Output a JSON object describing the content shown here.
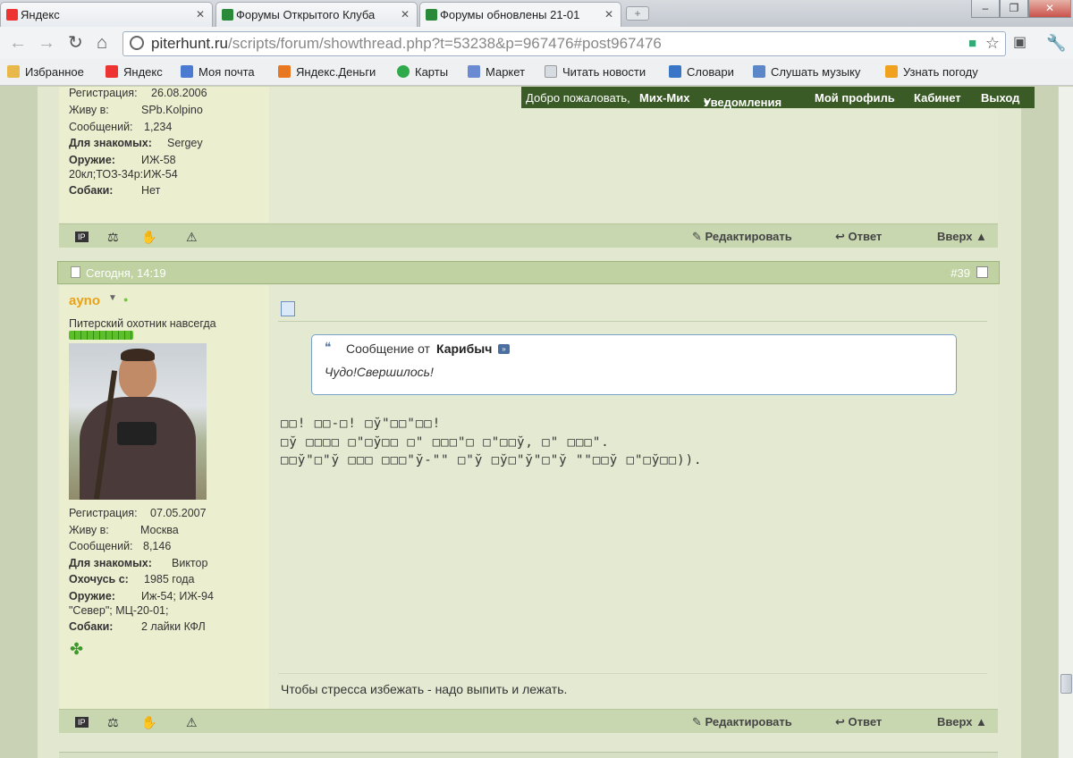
{
  "browser": {
    "tabs": [
      {
        "label": "Яндекс"
      },
      {
        "label": "Форумы Открытого Клуба"
      },
      {
        "label": "Форумы обновлены 21-01"
      }
    ],
    "url_host": "piterhunt.ru",
    "url_path": "/scripts/forum/showthread.php?t=53238&p=967476#post967476",
    "bookmarks": [
      "Избранное",
      "Яндекс",
      "Моя почта",
      "Яндекс.Деньги",
      "Карты",
      "Маркет",
      "Читать новости",
      "Словари",
      "Слушать музыку",
      "Узнать погоду"
    ]
  },
  "welcome_bar": {
    "greeting": "Добро пожаловать,",
    "username": "Мих-Мих",
    "notifications": "Уведомления",
    "profile": "Мой профиль",
    "cabinet": "Кабинет",
    "logout": "Выход"
  },
  "prev_post_user": {
    "reg_label": "Регистрация:",
    "reg_value": "26.08.2006",
    "live_label": "Живу в:",
    "live_value": "SPb.Kolpino",
    "msgs_label": "Сообщений:",
    "msgs_value": "1,234",
    "friends_label": "Для знакомых:",
    "friends_value": "Sergey",
    "weapon_label": "Оружие:",
    "weapon_value": "ИЖ-58",
    "weapon_value2": "20кл;ТОЗ-34р:ИЖ-54",
    "dogs_label": "Собаки:",
    "dogs_value": "Нет"
  },
  "post_actions": {
    "edit": "Редактировать",
    "reply": "Ответ",
    "top": "Вверх ▲"
  },
  "post": {
    "date": "Сегодня, 14:19",
    "number": "#39",
    "username": "ayno",
    "user_title": "Питерский охотник навсегда",
    "reg_label": "Регистрация:",
    "reg_value": "07.05.2007",
    "live_label": "Живу в:",
    "live_value": "Москва",
    "msgs_label": "Сообщений:",
    "msgs_value": "8,146",
    "friends_label": "Для знакомых:",
    "friends_value": "Виктор",
    "hunt_label": "Охочусь с:",
    "hunt_value": "1985 года",
    "weapon_label": "Оружие:",
    "weapon_value": "Иж-54; ИЖ-94",
    "weapon_value2": "\"Север\"; МЦ-20-01;",
    "dogs_label": "Собаки:",
    "dogs_value": "2 лайки КФЛ",
    "quote_prefix": "Сообщение от",
    "quote_author": "Карибыч",
    "quote_text": "Чудо!Свершилось!",
    "body_line1": "□□! □□-□! □ў\"□□\"□□!",
    "body_line2": "□ў □□□□ □\"□ў□□  □\" □□□\"□ □\"□□ў, □\" □□□\".",
    "body_line3": "□□ў\"□\"ў □□□ □□□\"ў-\"\" □\"ў □ў□\"ў\"□\"ў \"\"□□ў □\"□ў□□)).",
    "signature": "Чтобы стресса избежать - надо выпить и лежать."
  },
  "colors": {
    "accent_orange": "#e8a317",
    "welcome_bg": "#3a5a26",
    "post_head": "#c0d2a2"
  }
}
